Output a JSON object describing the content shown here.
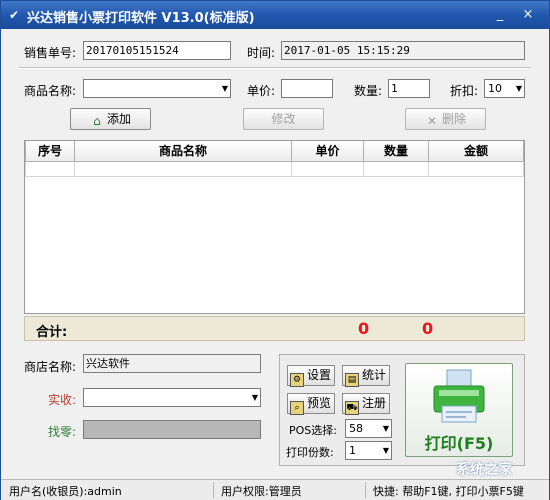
{
  "window": {
    "title": "兴达销售小票打印软件 V13.0(标准版)",
    "minimize_glyph": "_",
    "close_glyph": "×"
  },
  "header": {
    "order_no_label": "销售单号:",
    "order_no_value": "20170105151524",
    "time_label": "时间:",
    "time_value": "2017-01-05 15:15:29"
  },
  "entry": {
    "product_name_label": "商品名称:",
    "product_name_value": "",
    "price_label": "单价:",
    "price_value": "",
    "qty_label": "数量:",
    "qty_value": "1",
    "discount_label": "折扣:",
    "discount_value": "10"
  },
  "actions": {
    "add_label": "添加",
    "edit_label": "修改",
    "delete_label": "删除"
  },
  "table": {
    "columns": [
      "序号",
      "商品名称",
      "单价",
      "数量",
      "金额"
    ],
    "rows": []
  },
  "totals": {
    "label": "合计:",
    "quantity": "0",
    "amount": "0"
  },
  "checkout": {
    "store_name_label": "商店名称:",
    "store_name_value": "兴达软件",
    "received_label": "实收:",
    "received_value": "",
    "change_label": "找零:",
    "change_value": ""
  },
  "tools": {
    "settings_label": "设置",
    "stats_label": "统计",
    "preview_label": "预览",
    "register_label": "注册",
    "pos_label": "POS选择:",
    "pos_value": "58",
    "copies_label": "打印份数:",
    "copies_value": "1",
    "print_label": "打印(F5)"
  },
  "status": {
    "user": "用户名(收银员):admin",
    "role": "用户权限:管理员",
    "shortcut": "快捷: 帮助F1键, 打印小票F5键",
    "watermark": "系统之家"
  },
  "colors": {
    "title_bar": "#1f56ad",
    "total_value": "#e8141e",
    "print_text": "#1f7f1f",
    "received_label": "#c0392b",
    "change_label": "#2e7d32"
  }
}
